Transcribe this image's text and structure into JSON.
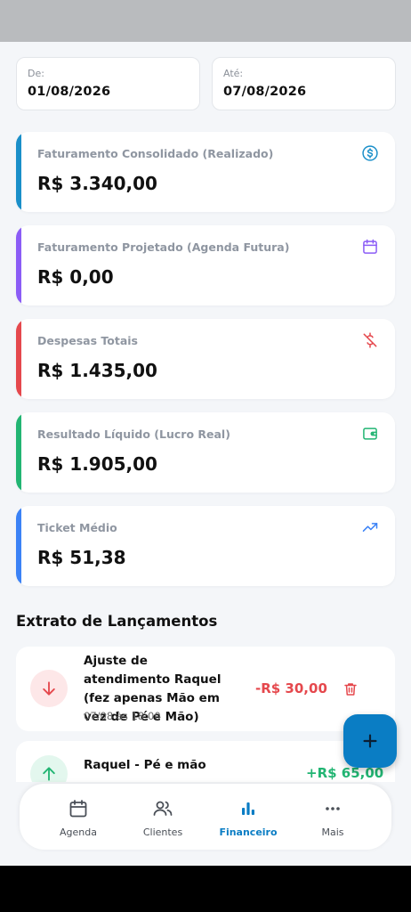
{
  "filters": {
    "from": {
      "label": "De:",
      "value": "01/08/2026"
    },
    "to": {
      "label": "Até:",
      "value": "07/08/2026"
    }
  },
  "cards": [
    {
      "title": "Faturamento Consolidado (Realizado)",
      "value": "R$ 3.340,00",
      "accent": "#1a8fc9",
      "icon": "dollar-circle-icon"
    },
    {
      "title": "Faturamento Projetado (Agenda Futura)",
      "value": "R$ 0,00",
      "accent": "#8b5cf6",
      "icon": "calendar-icon"
    },
    {
      "title": "Despesas Totais",
      "value": "R$ 1.435,00",
      "accent": "#e5484d",
      "icon": "dollar-off-icon"
    },
    {
      "title": "Resultado Líquido (Lucro Real)",
      "value": "R$ 1.905,00",
      "accent": "#22b573",
      "icon": "wallet-icon"
    },
    {
      "title": "Ticket Médio",
      "value": "R$ 51,38",
      "accent": "#3b82f6",
      "icon": "trending-up-icon"
    }
  ],
  "statement": {
    "title": "Extrato de Lançamentos",
    "items": [
      {
        "description": "Ajuste de atendimento Raquel (fez apenas Mão em vez de Pé e Mão)",
        "date": "07/08 às 18:00",
        "amount": "-R$ 30,00",
        "type": "expense",
        "color": "#e5484d"
      },
      {
        "description": "Raquel - Pé e mão",
        "date": "",
        "amount": "+R$ 65,00",
        "type": "income",
        "color": "#22b573"
      }
    ]
  },
  "fab": {
    "icon": "plus-icon"
  },
  "nav": {
    "items": [
      {
        "label": "Agenda",
        "icon": "calendar-icon",
        "active": false
      },
      {
        "label": "Clientes",
        "icon": "users-icon",
        "active": false
      },
      {
        "label": "Financeiro",
        "icon": "bar-chart-icon",
        "active": true
      },
      {
        "label": "Mais",
        "icon": "more-icon",
        "active": false
      }
    ],
    "active_color": "#0a7dc4"
  }
}
